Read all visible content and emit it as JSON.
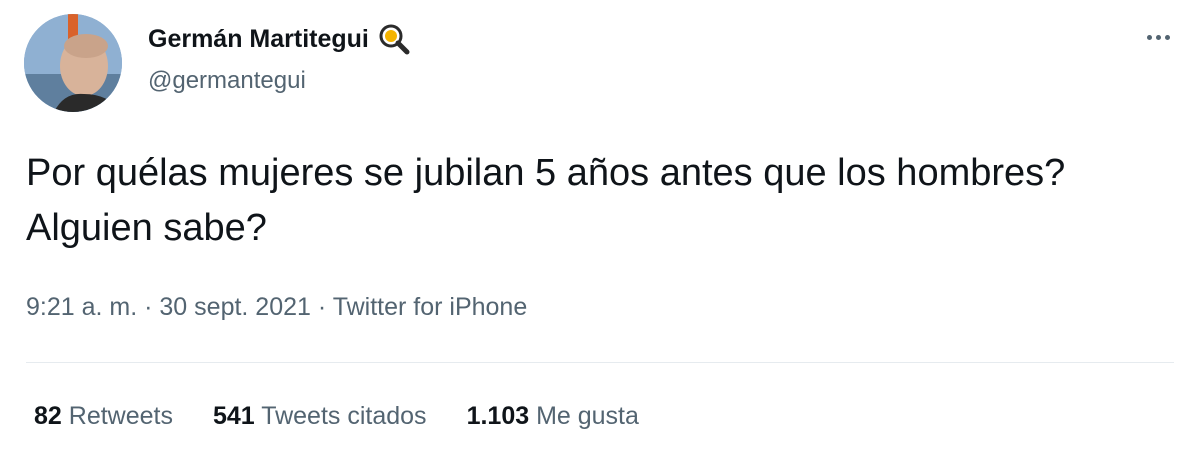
{
  "user": {
    "display_name": "Germán Martitegui",
    "handle": "@germantegui",
    "badge_icon": "magnifying-glass-icon"
  },
  "tweet": {
    "text": "Por quélas mujeres se jubilan 5 años antes que los hombres? Alguien sabe?",
    "time": "9:21 a. m.",
    "separator": "·",
    "date": "30 sept. 2021",
    "source": "Twitter for iPhone"
  },
  "stats": {
    "retweets_count": "82",
    "retweets_label": "Retweets",
    "quotes_count": "541",
    "quotes_label": "Tweets citados",
    "likes_count": "1.103",
    "likes_label": "Me gusta"
  },
  "more_icon": "more-options-icon",
  "colors": {
    "text_primary": "#0f1419",
    "text_secondary": "#536471",
    "divider": "#e6ebef"
  }
}
